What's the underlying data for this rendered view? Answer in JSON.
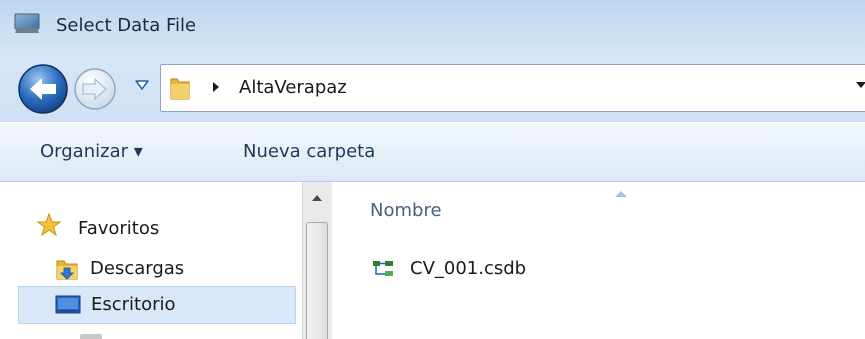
{
  "window": {
    "title": "Select Data File",
    "title_icon": "monitor-icon"
  },
  "nav": {
    "back_icon": "back-arrow-icon",
    "forward_icon": "forward-arrow-icon",
    "history_icon": "chevron-down-icon",
    "breadcrumb": {
      "folder_icon": "folder-icon",
      "separator_icon": "triangle-right-icon",
      "current": "AltaVerapaz"
    }
  },
  "toolbar": {
    "organize_label": "Organizar ▾",
    "new_folder_label": "Nueva carpeta"
  },
  "sidebar": {
    "items": [
      {
        "label": "Favoritos",
        "icon": "star-icon"
      },
      {
        "label": "Descargas",
        "icon": "downloads-folder-icon"
      },
      {
        "label": "Escritorio",
        "icon": "desktop-icon",
        "selected": true
      }
    ]
  },
  "content": {
    "column_header": "Nombre",
    "sort": "ascending",
    "files": [
      {
        "name": "CV_001.csdb",
        "icon": "database-file-icon"
      }
    ]
  },
  "colors": {
    "titlebar": "#c9def3",
    "toolbar": "#e7f0fa",
    "selected_item": "#d9e8f8",
    "header_text": "#4c607a",
    "link_text": "#1e395b"
  }
}
